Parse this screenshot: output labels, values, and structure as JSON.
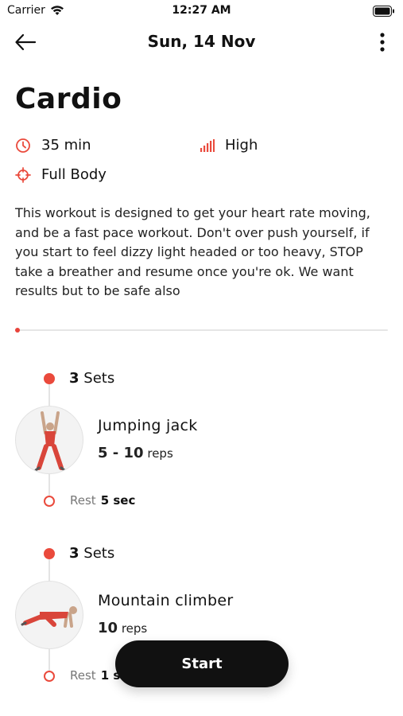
{
  "status_bar": {
    "carrier": "Carrier",
    "time": "12:27 AM"
  },
  "nav": {
    "title": "Sun, 14 Nov"
  },
  "workout": {
    "title": "Cardio",
    "duration": "35 min",
    "level": "High",
    "focus": "Full Body",
    "description": "This workout is designed to get your heart rate moving, and be a fast pace workout. Don't over push yourself, if you start to feel dizzy light headed or too heavy, STOP take a breather and resume once you're ok. We want results but to be safe also",
    "progress": 0
  },
  "exercises": [
    {
      "sets_count": "3",
      "sets_label": "Sets",
      "name": "Jumping jack",
      "reps_value": "5 - 10",
      "reps_unit": "reps",
      "rest_label": "Rest",
      "rest_value": "5 sec"
    },
    {
      "sets_count": "3",
      "sets_label": "Sets",
      "name": "Mountain climber",
      "reps_value": "10",
      "reps_unit": "reps",
      "rest_label": "Rest",
      "rest_value": "1 sec"
    }
  ],
  "start_button": {
    "label": "Start"
  },
  "colors": {
    "accent": "#ea4a3c",
    "button": "#111111"
  },
  "icons": {
    "duration": "clock-icon",
    "level": "signal-bars-icon",
    "focus": "target-icon"
  }
}
